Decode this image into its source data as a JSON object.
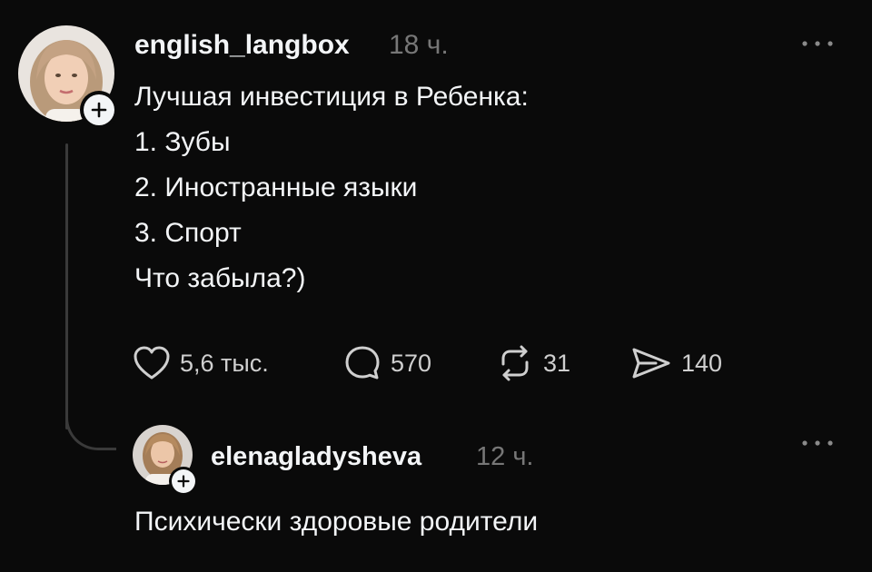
{
  "post": {
    "username": "english_langbox",
    "time": "18 ч.",
    "more": "...",
    "lines": [
      "Лучшая инвестиция в Ребенка:",
      "1. Зубы",
      "2. Иностранные языки",
      "3. Спорт",
      "Что забыла?)"
    ],
    "actions": {
      "likes": "5,6 тыс.",
      "comments": "570",
      "reposts": "31",
      "shares": "140"
    }
  },
  "reply": {
    "username": "elenagladysheva",
    "time": "12 ч.",
    "more": "...",
    "text": "Психически здоровые родители"
  },
  "icons": {
    "follow": "plus-icon",
    "like": "heart-icon",
    "comment": "comment-bubble-icon",
    "repost": "repost-icon",
    "share": "send-icon",
    "more": "more-dots-icon"
  },
  "colors": {
    "background": "#0a0a0a",
    "text": "#f3f5f7",
    "muted": "#777777",
    "thread_line": "#3a3a3a"
  }
}
